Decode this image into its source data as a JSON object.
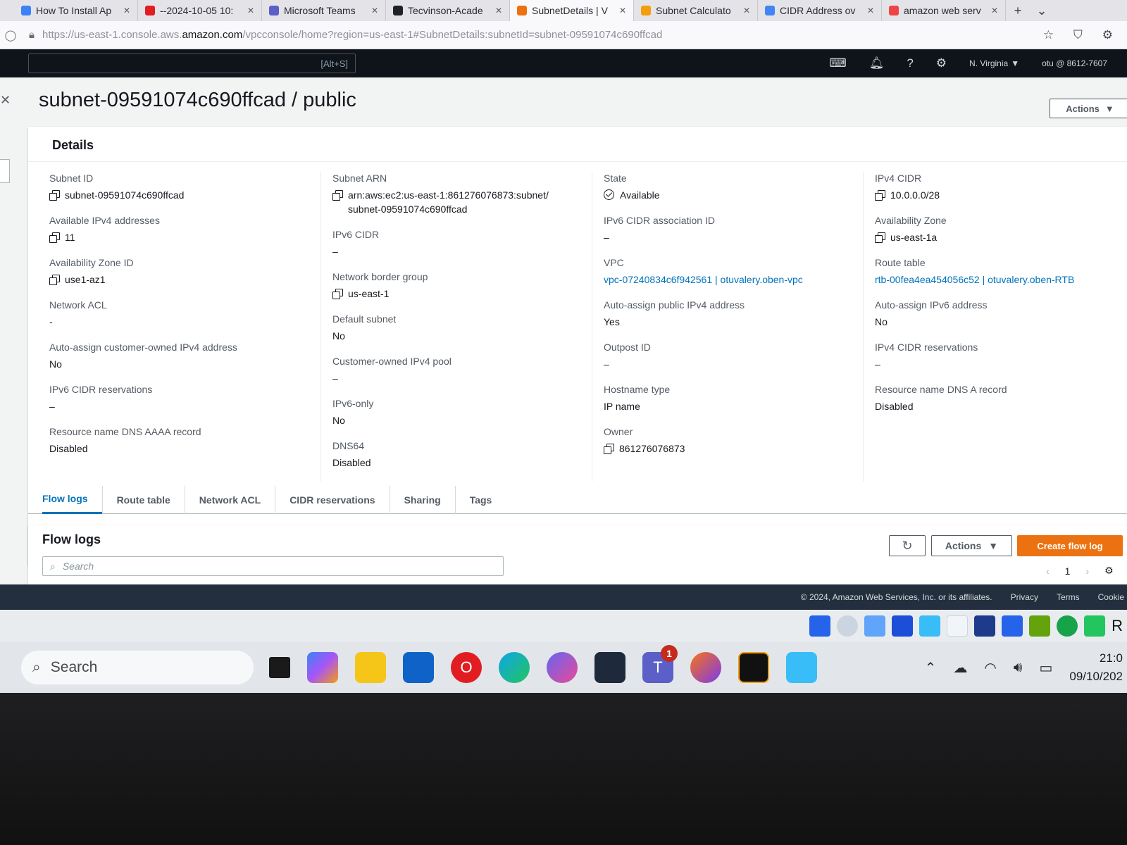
{
  "browser": {
    "tabs": [
      {
        "label": "How To Install Ap",
        "color": "#3b82f6"
      },
      {
        "label": "--2024-10-05 10:",
        "color": "#e11d21"
      },
      {
        "label": "Microsoft Teams",
        "color": "#5b5fc7"
      },
      {
        "label": "Tecvinson-Acade",
        "color": "#1f2328"
      },
      {
        "label": "SubnetDetails | V",
        "color": "#ec7211",
        "active": true
      },
      {
        "label": "Subnet Calculato",
        "color": "#f59e0b"
      },
      {
        "label": "CIDR Address ov",
        "color": "#4285f4"
      },
      {
        "label": "amazon web serv",
        "color": "#ef4444"
      }
    ],
    "new_tab_label": "+",
    "tab_list_label": "⌄",
    "url_prefix": "https://us-east-1.console.aws.",
    "url_host": "amazon.com",
    "url_path": "/vpcconsole/home?region=us-east-1#SubnetDetails:subnetId=subnet-09591074c690ffcad"
  },
  "aws_nav": {
    "search_shortcut": "[Alt+S]",
    "region": "N. Virginia",
    "account": "otu @ 8612-7607"
  },
  "page": {
    "title": "subnet-09591074c690ffcad / public",
    "actions_label": "Actions",
    "details_heading": "Details"
  },
  "details": {
    "col1": [
      {
        "label": "Subnet ID",
        "value": "subnet-09591074c690ffcad",
        "copy": true
      },
      {
        "label": "Available IPv4 addresses",
        "value": "11",
        "copy": true
      },
      {
        "label": "Availability Zone ID",
        "value": "use1-az1",
        "copy": true
      },
      {
        "label": "Network ACL",
        "value": "-"
      },
      {
        "label": "Auto-assign customer-owned IPv4 address",
        "value": "No"
      },
      {
        "label": "IPv6 CIDR reservations",
        "value": "–"
      },
      {
        "label": "Resource name DNS AAAA record",
        "value": "Disabled"
      }
    ],
    "col2": [
      {
        "label": "Subnet ARN",
        "value": "arn:aws:ec2:us-east-1:861276076873:subnet/ subnet-09591074c690ffcad",
        "copy": true
      },
      {
        "label": "IPv6 CIDR",
        "value": "–"
      },
      {
        "label": "Network border group",
        "value": "us-east-1",
        "copy": true
      },
      {
        "label": "Default subnet",
        "value": "No"
      },
      {
        "label": "Customer-owned IPv4 pool",
        "value": "–"
      },
      {
        "label": "IPv6-only",
        "value": "No"
      },
      {
        "label": "DNS64",
        "value": "Disabled"
      }
    ],
    "col3": [
      {
        "label": "State",
        "value": "Available",
        "status": true
      },
      {
        "label": "IPv6 CIDR association ID",
        "value": "–"
      },
      {
        "label": "VPC",
        "value": "vpc-07240834c6f942561 | otuvalery.oben-vpc",
        "link": true
      },
      {
        "label": "Auto-assign public IPv4 address",
        "value": "Yes"
      },
      {
        "label": "Outpost ID",
        "value": "–"
      },
      {
        "label": "Hostname type",
        "value": "IP name"
      },
      {
        "label": "Owner",
        "value": "861276076873",
        "copy": true
      }
    ],
    "col4": [
      {
        "label": "IPv4 CIDR",
        "value": "10.0.0.0/28",
        "copy": true
      },
      {
        "label": "Availability Zone",
        "value": "us-east-1a",
        "copy": true
      },
      {
        "label": "Route table",
        "value": "rtb-00fea4ea454056c52 | otuvalery.oben-RTB",
        "link": true
      },
      {
        "label": "Auto-assign IPv6 address",
        "value": "No"
      },
      {
        "label": "IPv4 CIDR reservations",
        "value": "–"
      },
      {
        "label": "Resource name DNS A record",
        "value": "Disabled"
      }
    ]
  },
  "content_tabs": [
    "Flow logs",
    "Route table",
    "Network ACL",
    "CIDR reservations",
    "Sharing",
    "Tags"
  ],
  "flow_logs": {
    "heading": "Flow logs",
    "search_placeholder": "Search",
    "actions_label": "Actions",
    "create_label": "Create flow log",
    "page_number": "1"
  },
  "footer": {
    "copyright": "© 2024, Amazon Web Services, Inc. or its affiliates.",
    "privacy": "Privacy",
    "terms": "Terms",
    "cookie": "Cookie"
  },
  "taskbar": {
    "search_label": "Search",
    "teams_badge": "1",
    "clock_time": "21:0",
    "clock_date": "09/10/202",
    "tray_letter": "R"
  },
  "colors": {
    "aws_orange": "#ec7211",
    "aws_link": "#0073bb",
    "aws_nav_bg": "#0f141a"
  }
}
